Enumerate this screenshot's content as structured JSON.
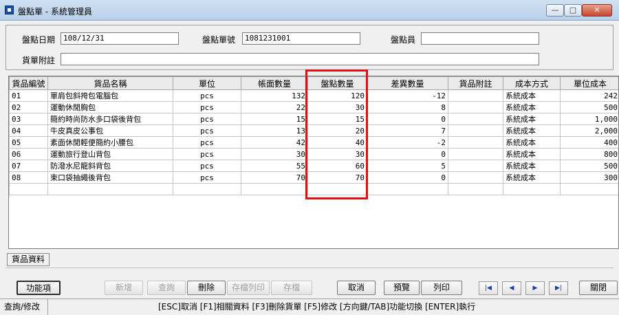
{
  "window": {
    "title": "盤點單 - 系統管理員",
    "min_label": "—",
    "max_label": "□",
    "close_label": "✕"
  },
  "form": {
    "date_label": "盤點日期",
    "date_value": "108/12/31",
    "number_label": "盤點單號",
    "number_value": "1081231001",
    "person_label": "盤點員",
    "person_value": "",
    "note_label": "貨單附註",
    "note_value": ""
  },
  "grid": {
    "headers": [
      "貨品編號",
      "貨品名稱",
      "單位",
      "帳面數量",
      "盤點數量",
      "差異數量",
      "貨品附註",
      "成本方式",
      "單位成本"
    ],
    "rows": [
      {
        "code": "01",
        "name": "單肩包斜挎包電腦包",
        "unit": "pcs",
        "book": "132",
        "counted": "120",
        "diff": "-12",
        "note": "",
        "method": "系統成本",
        "cost": "242"
      },
      {
        "code": "02",
        "name": "運動休閒胸包",
        "unit": "pcs",
        "book": "22",
        "counted": "30",
        "diff": "8",
        "note": "",
        "method": "系統成本",
        "cost": "500"
      },
      {
        "code": "03",
        "name": "簡約時尚防水多口袋後背包",
        "unit": "pcs",
        "book": "15",
        "counted": "15",
        "diff": "0",
        "note": "",
        "method": "系統成本",
        "cost": "1,000"
      },
      {
        "code": "04",
        "name": "牛皮真皮公事包",
        "unit": "pcs",
        "book": "13",
        "counted": "20",
        "diff": "7",
        "note": "",
        "method": "系統成本",
        "cost": "2,000"
      },
      {
        "code": "05",
        "name": "素面休閒輕便簡約小腰包",
        "unit": "pcs",
        "book": "42",
        "counted": "40",
        "diff": "-2",
        "note": "",
        "method": "系統成本",
        "cost": "400"
      },
      {
        "code": "06",
        "name": "運動旅行登山背包",
        "unit": "pcs",
        "book": "30",
        "counted": "30",
        "diff": "0",
        "note": "",
        "method": "系統成本",
        "cost": "800"
      },
      {
        "code": "07",
        "name": "防潑水尼龍斜背包",
        "unit": "pcs",
        "book": "55",
        "counted": "60",
        "diff": "5",
        "note": "",
        "method": "系統成本",
        "cost": "500"
      },
      {
        "code": "08",
        "name": "束口袋抽繩後背包",
        "unit": "pcs",
        "book": "70",
        "counted": "70",
        "diff": "0",
        "note": "",
        "method": "系統成本",
        "cost": "300"
      }
    ],
    "highlight_color": "#e01010"
  },
  "tabs": {
    "item_data": "貨品資料"
  },
  "buttons": {
    "func": "功能項",
    "add": "新增",
    "query": "查詢",
    "delete": "刪除",
    "save_print": "存檔列印",
    "save": "存檔",
    "cancel": "取消",
    "preview": "預覽",
    "print": "列印",
    "close": "關閉"
  },
  "nav": {
    "first": "|◀",
    "prev": "◀",
    "next": "▶",
    "last": "▶|"
  },
  "status": {
    "mode": "查詢/修改",
    "help": "[ESC]取消 [F1]相關資料 [F3]刪除貨單 [F5]修改 [方向鍵/TAB]功能切換 [ENTER]執行"
  }
}
